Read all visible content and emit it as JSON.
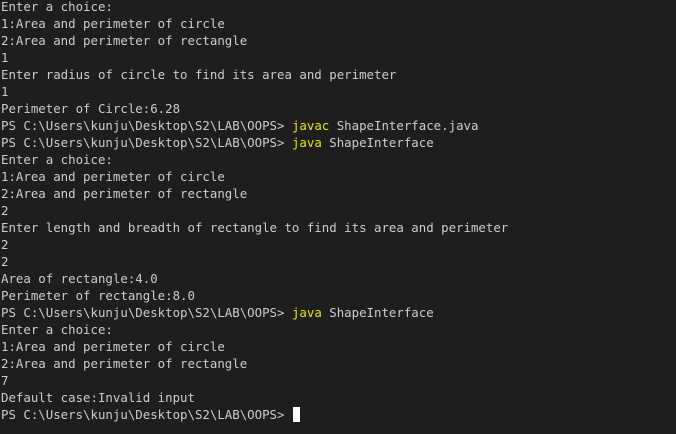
{
  "colors": {
    "background": "#1e1e1e",
    "text": "#cccccc",
    "command": "#e5e510",
    "cursor": "#ffffff"
  },
  "prompt": "PS C:\\Users\\kunju\\Desktop\\S2\\LAB\\OOPS> ",
  "lines": [
    "Enter a choice:",
    "1:Area and perimeter of circle",
    "2:Area and perimeter of rectangle",
    "1",
    "Enter radius of circle to find its area and perimeter",
    "1",
    "Perimeter of Circle:6.28"
  ],
  "compile": {
    "command": "javac",
    "args": " ShapeInterface.java"
  },
  "run1": {
    "command": "java",
    "args": " ShapeInterface",
    "output": [
      "Enter a choice:",
      "1:Area and perimeter of circle",
      "2:Area and perimeter of rectangle",
      "2",
      "Enter length and breadth of rectangle to find its area and perimeter",
      "2",
      "2",
      "Area of rectangle:4.0",
      "Perimeter of rectangle:8.0"
    ]
  },
  "run2": {
    "command": "java",
    "args": " ShapeInterface",
    "output": [
      "Enter a choice:",
      "1:Area and perimeter of circle",
      "2:Area and perimeter of rectangle",
      "7",
      "Default case:Invalid input"
    ]
  }
}
